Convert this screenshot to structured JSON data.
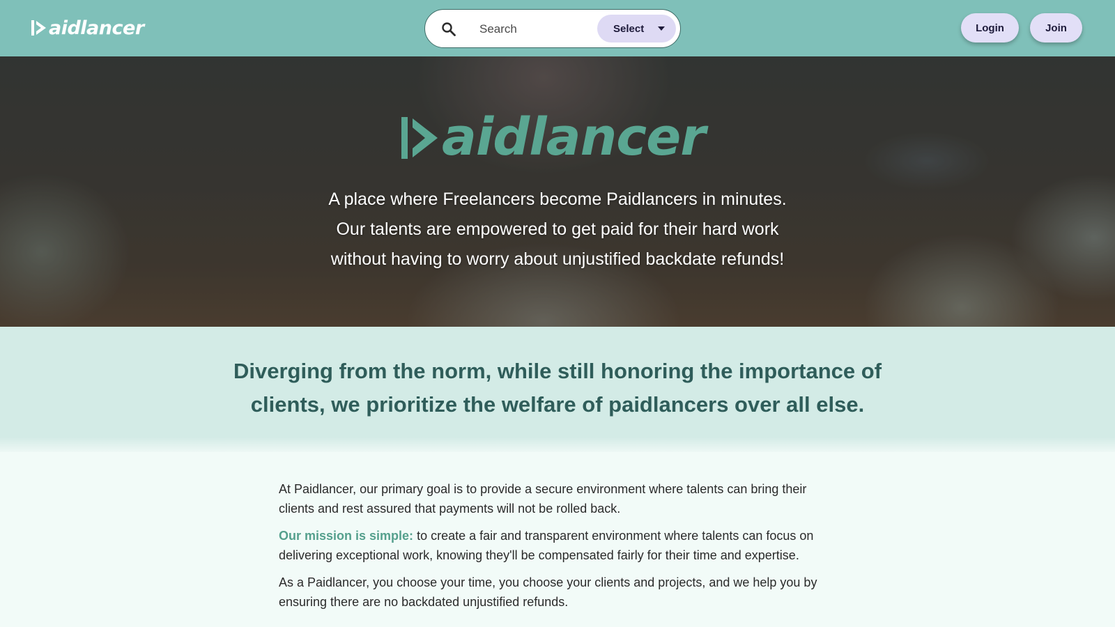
{
  "header": {
    "logo_text": "aidlancer",
    "search": {
      "placeholder": "Search",
      "value": ""
    },
    "select_label": "Select",
    "login_label": "Login",
    "join_label": "Join"
  },
  "hero": {
    "logo_text": "aidlancer",
    "tagline": [
      "A place where Freelancers become Paidlancers in minutes.",
      "Our talents are empowered to get paid for their hard work",
      "without having to worry about unjustified backdate refunds!"
    ]
  },
  "highlight": {
    "lines": [
      "Diverging from the norm, while still honoring the importance of",
      "clients, we prioritize the welfare of paidlancers over all else."
    ]
  },
  "about": {
    "p1": [
      "At Paidlancer, our primary goal is to provide a secure environment where talents can bring their",
      "clients and rest assured that payments will not be rolled back."
    ],
    "mission_label": "Our mission is simple:",
    "p2_line1_rest": " to create a fair and transparent environment where talents can focus on",
    "p2_line2": "delivering exceptional work, knowing they'll be compensated fairly for their time and expertise.",
    "p3": [
      "As a Paidlancer, you choose your time, you choose your clients and projects, and we help you by",
      "ensuring there are no backdated unjustified refunds."
    ]
  },
  "colors": {
    "navbar": "#7fc0b9",
    "brand_green": "#5aa692",
    "accent_text": "#55a08d",
    "heading_text": "#2f5d5a",
    "button_bg": "#e2dff7",
    "highlight_band": "#d3ebe6",
    "page_bg": "#f2fbf8"
  },
  "icons": {
    "logo_mark": "play-bar-logo-icon",
    "search": "search-icon",
    "select_caret": "caret-down-icon"
  }
}
